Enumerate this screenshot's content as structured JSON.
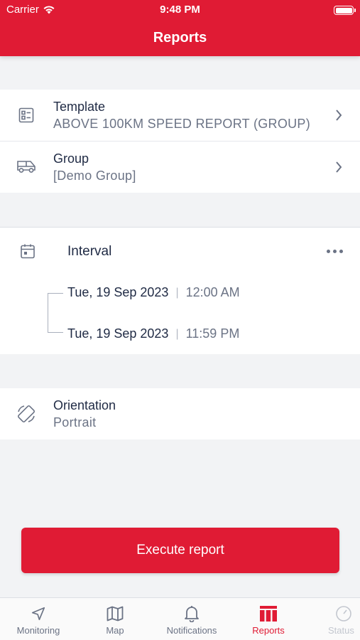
{
  "status_bar": {
    "carrier": "Carrier",
    "time": "9:48 PM"
  },
  "header": {
    "title": "Reports"
  },
  "template": {
    "label": "Template",
    "value": "ABOVE 100KM SPEED REPORT (GROUP)"
  },
  "group": {
    "label": "Group",
    "value": "[Demo Group]"
  },
  "interval": {
    "label": "Interval",
    "start": {
      "date": "Tue, 19 Sep 2023",
      "time": "12:00 AM"
    },
    "end": {
      "date": "Tue, 19 Sep 2023",
      "time": "11:59 PM"
    }
  },
  "orientation": {
    "label": "Orientation",
    "value": "Portrait"
  },
  "execute_button": {
    "label": "Execute report"
  },
  "tabs": [
    {
      "label": "Monitoring",
      "icon": "navigation-arrow-icon"
    },
    {
      "label": "Map",
      "icon": "map-icon"
    },
    {
      "label": "Notifications",
      "icon": "bell-icon"
    },
    {
      "label": "Reports",
      "icon": "table-icon",
      "active": true
    },
    {
      "label": "Status",
      "icon": "gauge-icon"
    }
  ],
  "colors": {
    "accent": "#e01b34",
    "text": "#1f2a44",
    "muted": "#6b7385",
    "background": "#f2f3f5"
  }
}
